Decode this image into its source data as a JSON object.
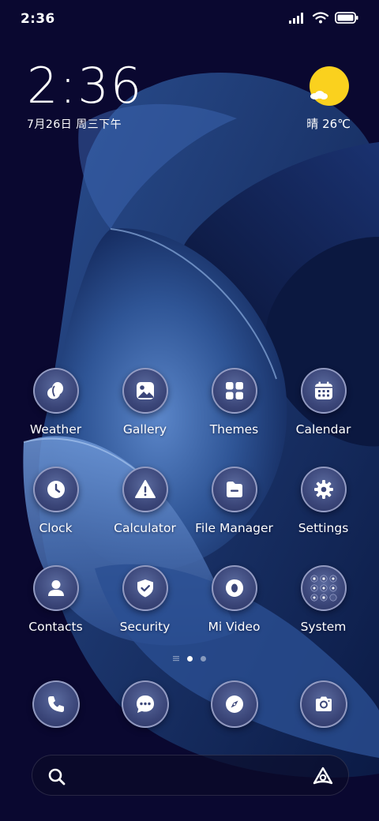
{
  "status_bar": {
    "time": "2:36",
    "icons": [
      "signal-icon",
      "wifi-icon",
      "battery-icon"
    ]
  },
  "clock_widget": {
    "time": "2:36",
    "date": "7月26日 周三下午"
  },
  "weather_widget": {
    "icon": "sun-cloud-icon",
    "text": "晴 26℃"
  },
  "apps": [
    {
      "label": "Weather",
      "icon": "weather-icon"
    },
    {
      "label": "Gallery",
      "icon": "gallery-icon"
    },
    {
      "label": "Themes",
      "icon": "themes-icon"
    },
    {
      "label": "Calendar",
      "icon": "calendar-icon"
    },
    {
      "label": "Clock",
      "icon": "clock-icon"
    },
    {
      "label": "Calculator",
      "icon": "calculator-icon"
    },
    {
      "label": "File Manager",
      "icon": "file-manager-icon"
    },
    {
      "label": "Settings",
      "icon": "settings-icon"
    },
    {
      "label": "Contacts",
      "icon": "contacts-icon"
    },
    {
      "label": "Security",
      "icon": "security-icon"
    },
    {
      "label": "Mi Video",
      "icon": "mi-video-icon"
    },
    {
      "label": "System",
      "icon": "system-folder-icon"
    }
  ],
  "dock": [
    {
      "icon": "phone-icon"
    },
    {
      "icon": "messages-icon"
    },
    {
      "icon": "browser-icon"
    },
    {
      "icon": "camera-icon"
    }
  ],
  "page_indicator": {
    "pages": 2,
    "active": 1
  },
  "search": {
    "icon": "search-icon",
    "assistant_icon": "assistant-icon"
  },
  "colors": {
    "background": "#0a0830",
    "sun": "#fad11e",
    "icon_fill": "#3b4679"
  }
}
